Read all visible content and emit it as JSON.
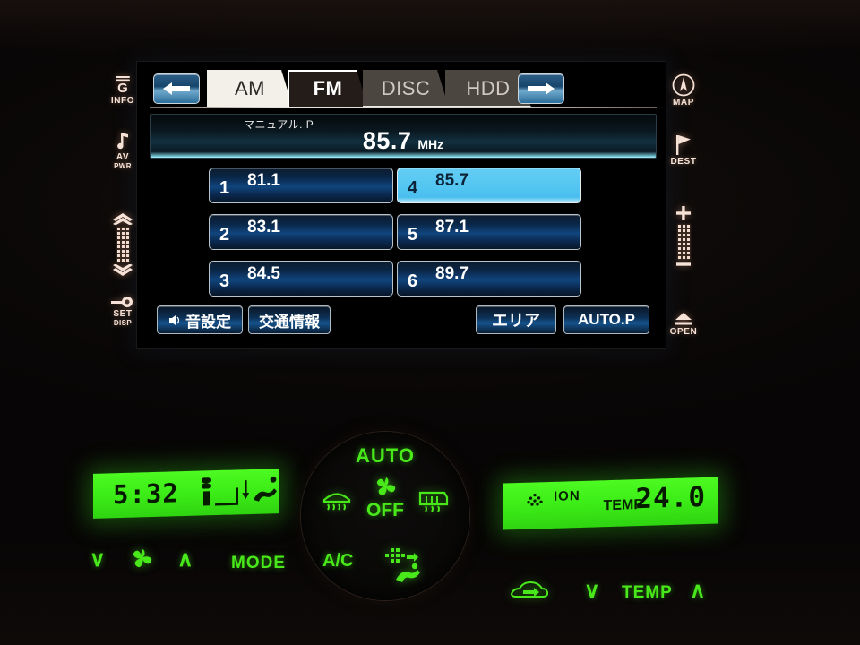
{
  "head_unit": {
    "nav_arrows": {
      "prev": "prev-source-arrow",
      "next": "next-source-arrow"
    },
    "tabs": [
      {
        "label": "AM",
        "state": "light"
      },
      {
        "label": "FM",
        "state": "active"
      },
      {
        "label": "DISC",
        "state": "inactive"
      },
      {
        "label": "HDD",
        "state": "inactive"
      }
    ],
    "now_playing": {
      "mode_label": "マニュアル. P",
      "frequency": "85.7",
      "unit": "MHz"
    },
    "presets": [
      {
        "no": "1",
        "freq": "81.1",
        "selected": false
      },
      {
        "no": "2",
        "freq": "83.1",
        "selected": false
      },
      {
        "no": "3",
        "freq": "84.5",
        "selected": false
      },
      {
        "no": "4",
        "freq": "85.7",
        "selected": true
      },
      {
        "no": "5",
        "freq": "87.1",
        "selected": false
      },
      {
        "no": "6",
        "freq": "89.7",
        "selected": false
      }
    ],
    "function_buttons": {
      "sound_settings": "音設定",
      "traffic_info": "交通情報",
      "area": "エリア",
      "auto_preset": "AUTO.P"
    }
  },
  "hard_keys": {
    "left": [
      {
        "id": "info",
        "label": "INFO",
        "sub": ""
      },
      {
        "id": "avpwr",
        "label": "AV",
        "sub": "PWR"
      },
      {
        "id": "scroll",
        "label": "",
        "sub": ""
      },
      {
        "id": "set",
        "label": "SET",
        "sub": "DISP"
      }
    ],
    "right": [
      {
        "id": "map",
        "label": "MAP",
        "sub": ""
      },
      {
        "id": "dest",
        "label": "DEST",
        "sub": ""
      },
      {
        "id": "vol",
        "label": "",
        "sub": ""
      },
      {
        "id": "open",
        "label": "OPEN",
        "sub": ""
      }
    ]
  },
  "climate": {
    "left_display": {
      "clock": "5:32"
    },
    "right_display": {
      "ion_label": "ION",
      "temp_label": "TEMP",
      "temp_value": "24.0"
    },
    "dial": {
      "auto_label": "AUTO",
      "fan_state": "OFF",
      "ac_label": "A/C"
    },
    "controls": {
      "fan_down": "∨",
      "fan_up": "∧",
      "mode": "MODE",
      "temp_down": "∨",
      "temp_label": "TEMP",
      "temp_up": "∧"
    }
  },
  "colors": {
    "accent_blue": "#15538d",
    "selected_preset": "#54c6f2",
    "lcd_green": "#3ded17",
    "hardkey_amber": "#f6e2d6"
  }
}
